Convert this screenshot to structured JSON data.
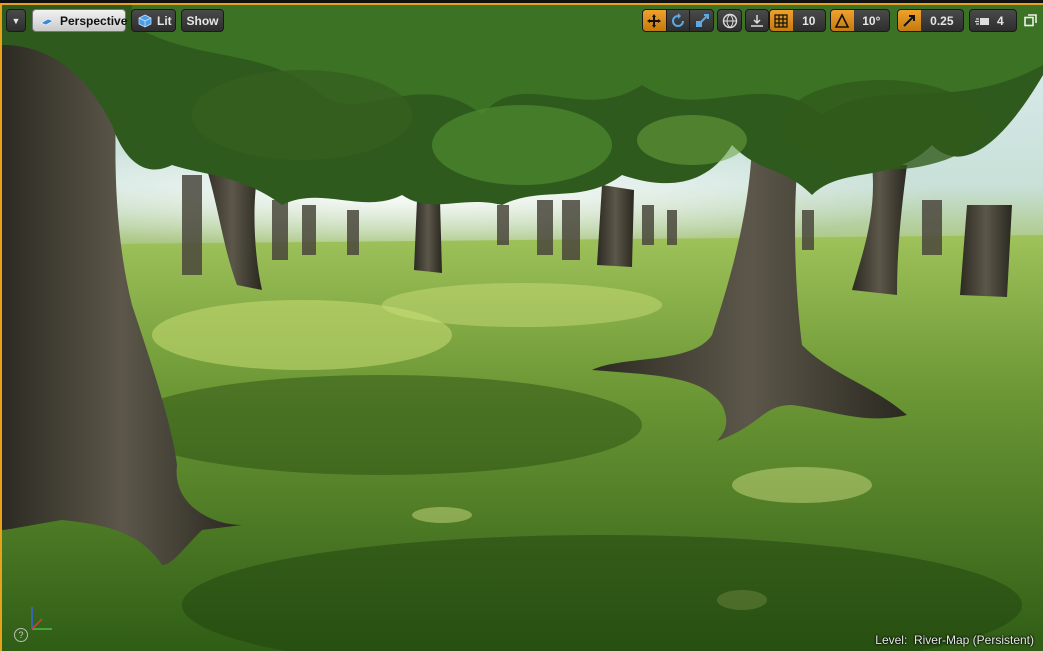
{
  "toolbar": {
    "view_mode": "Perspective",
    "lighting": "Lit",
    "show": "Show",
    "grid_snap": "10",
    "rotation_snap": "10°",
    "scale_snap": "0.25",
    "camera_speed": "4"
  },
  "status": {
    "level_prefix": "Level:",
    "level_name": "River-Map (Persistent)"
  },
  "colors": {
    "accent": "#E6A21B",
    "toolbar_bg": "#3A3A3A",
    "grass": "#4C7D24",
    "sky": "#DCEDEE"
  },
  "icons": {
    "menu": "chevron-down-icon",
    "perspective": "cube-perspective-icon",
    "lit": "lit-cube-icon",
    "translate": "move-arrows-icon",
    "rotate": "rotate-icon",
    "scale": "scale-icon",
    "world": "globe-icon",
    "surface_snap": "surface-snap-icon",
    "grid": "grid-icon",
    "angle": "angle-icon",
    "scale_snap": "scale-arrow-icon",
    "camera_speed": "camera-speed-icon",
    "maximize": "maximize-icon"
  }
}
